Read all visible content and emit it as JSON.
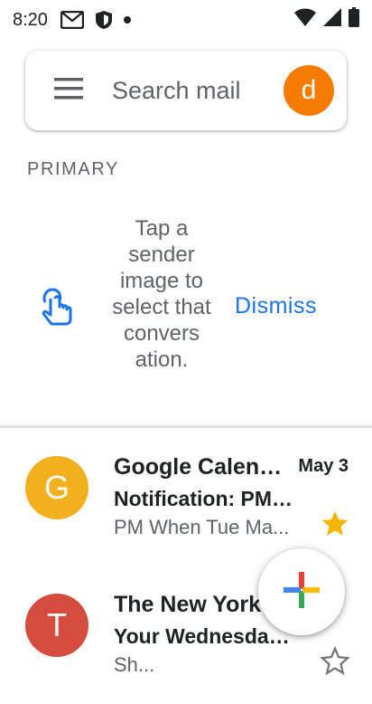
{
  "status_bar": {
    "time": "8:20",
    "icons": [
      "gmail-notification-icon",
      "shield-notification-icon",
      "dot-icon",
      "wifi-icon",
      "signal-icon",
      "battery-icon"
    ]
  },
  "search": {
    "placeholder": "Search mail",
    "account_initial": "d",
    "account_color": "#f57c00"
  },
  "section": {
    "label": "PRIMARY"
  },
  "tip": {
    "text": "Tap a sender image to select that convers ation.",
    "dismiss_label": "Dismiss"
  },
  "emails": [
    {
      "avatar_initial": "G",
      "avatar_color": "#f2b01e",
      "sender": "Google Calendar",
      "subject": "Notification: PM When Tue",
      "snippet": "PM When Tue Ma...",
      "date": "May 3",
      "starred": true
    },
    {
      "avatar_initial": "T",
      "avatar_color": "#d54c3e",
      "sender": "The New York Times",
      "subject": "Your Wednesday Briefing",
      "snippet": "Sh...",
      "date": "",
      "starred": false
    }
  ],
  "fab": {
    "icon": "compose-plus-icon"
  },
  "colors": {
    "accent": "#1a73e8",
    "star": "#f4b400"
  }
}
